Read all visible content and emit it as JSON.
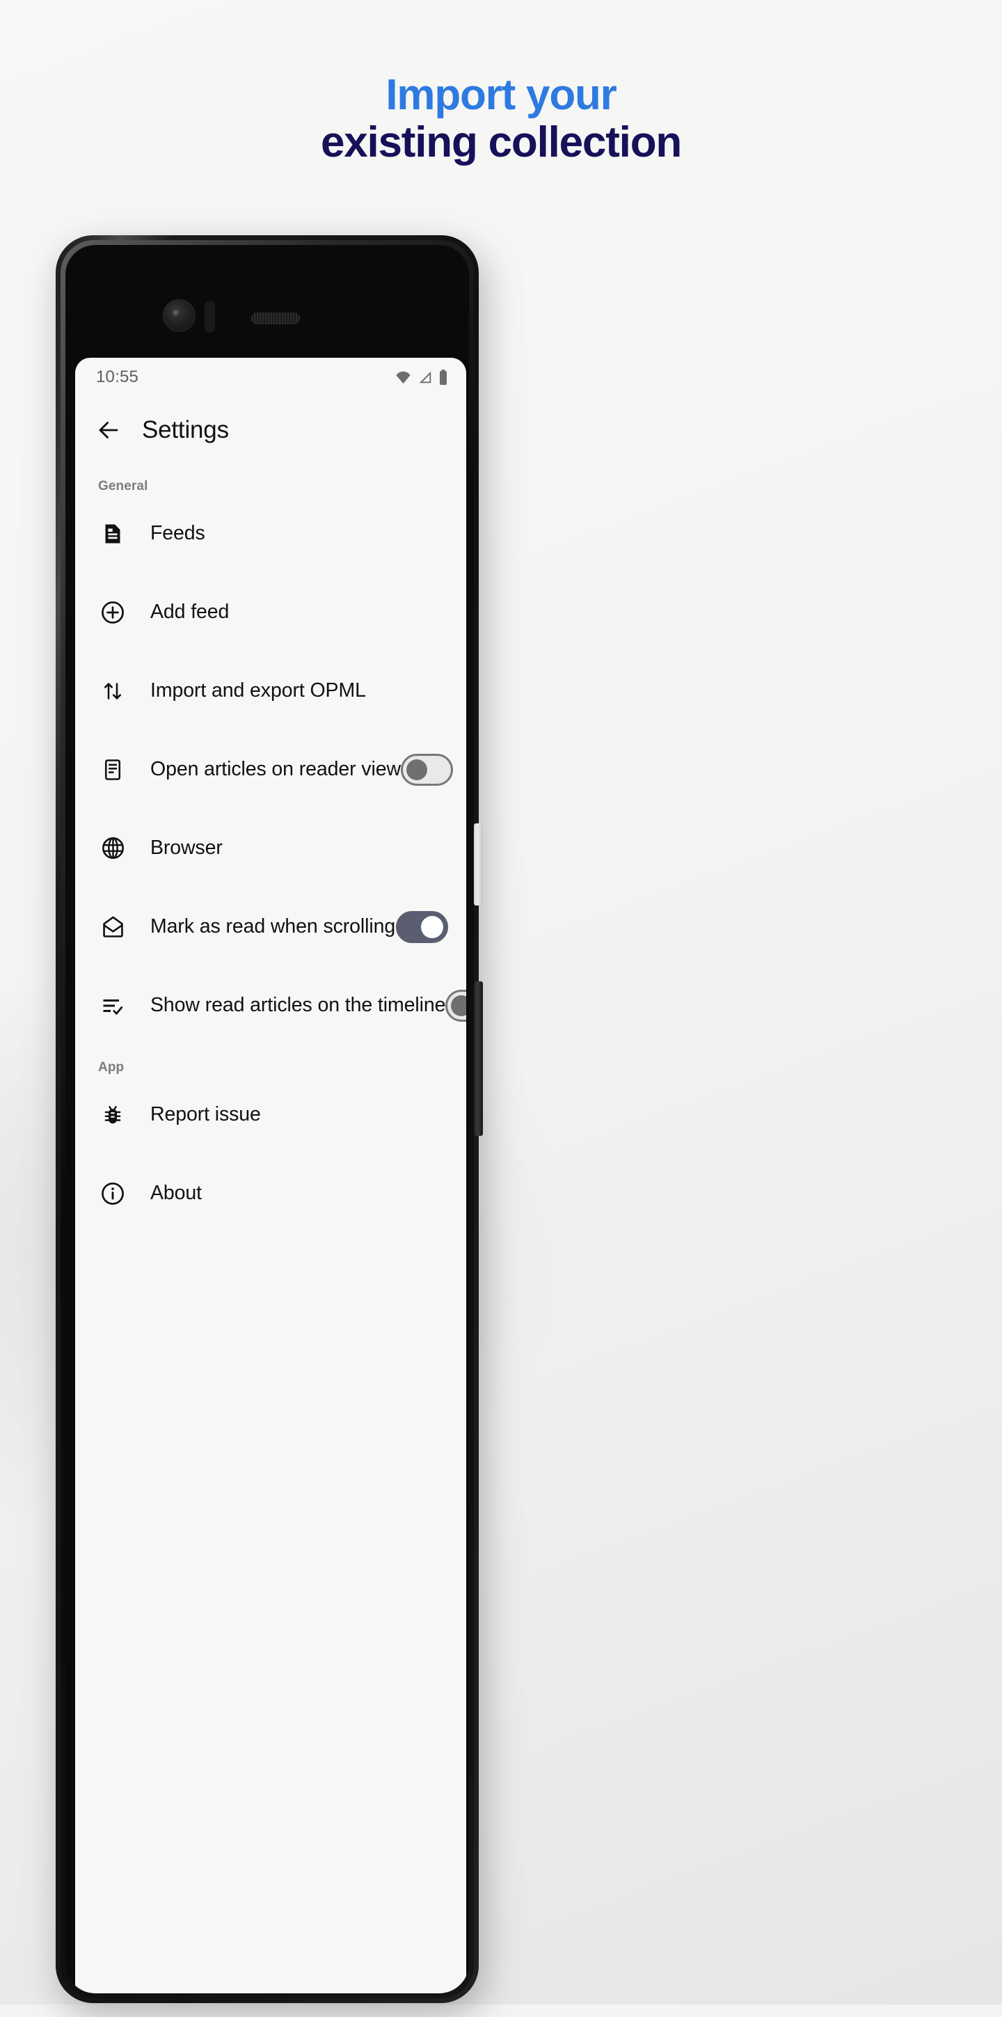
{
  "promo": {
    "headline_line1": "Import your",
    "headline_line2": "existing collection",
    "color_accent": "#2e7ae0",
    "color_dark": "#161159"
  },
  "phone": {
    "status_bar": {
      "time": "10:55",
      "icons": [
        "wifi-icon",
        "cellular-signal-icon",
        "battery-icon"
      ]
    },
    "app_bar": {
      "back_icon": "back-arrow-icon",
      "title": "Settings"
    },
    "sections": [
      {
        "label": "General",
        "items": [
          {
            "icon": "feeds-article-icon",
            "label": "Feeds",
            "control": "none"
          },
          {
            "icon": "plus-circle-icon",
            "label": "Add feed",
            "control": "none"
          },
          {
            "icon": "import-export-icon",
            "label": "Import and export OPML",
            "control": "none"
          },
          {
            "icon": "reader-view-icon",
            "label": "Open articles on reader view",
            "control": "toggle",
            "state": "off"
          },
          {
            "icon": "globe-icon",
            "label": "Browser",
            "control": "none"
          },
          {
            "icon": "mail-open-icon",
            "label": "Mark as read when scrolling",
            "control": "toggle",
            "state": "on"
          },
          {
            "icon": "list-check-icon",
            "label": "Show read articles on the timeline",
            "control": "toggle",
            "state": "off"
          }
        ]
      },
      {
        "label": "App",
        "items": [
          {
            "icon": "bug-icon",
            "label": "Report issue",
            "control": "none"
          },
          {
            "icon": "info-circle-icon",
            "label": "About",
            "control": "none"
          }
        ]
      }
    ],
    "hardware": {
      "camera": "front-camera",
      "earpiece": "earpiece-speaker",
      "power_button": "power-button",
      "volume_button": "volume-rocker"
    }
  }
}
